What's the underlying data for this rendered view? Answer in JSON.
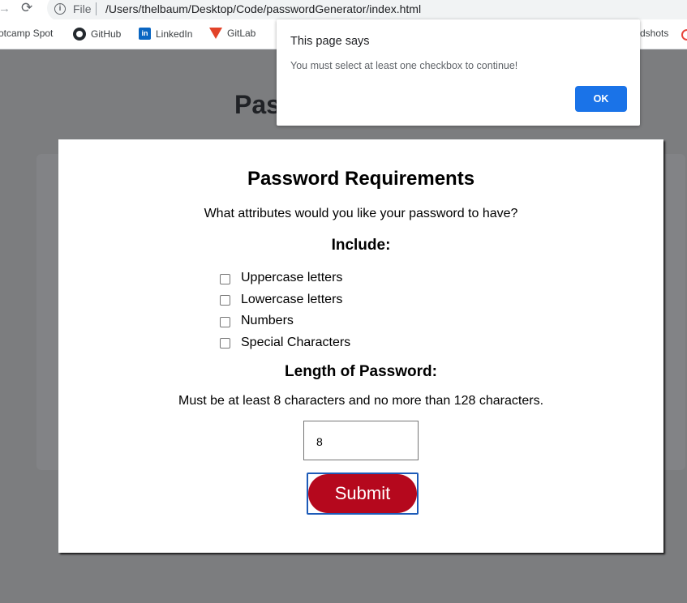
{
  "browser": {
    "file_label": "File",
    "url": "/Users/thelbaum/Desktop/Code/passwordGenerator/index.html",
    "bookmarks": [
      {
        "label": "otcamp Spot",
        "icon": "bootcamp-spot-icon"
      },
      {
        "label": "GitHub",
        "icon": "github-icon"
      },
      {
        "label": "LinkedIn",
        "icon": "linkedin-icon"
      },
      {
        "label": "GitLab",
        "icon": "gitlab-icon"
      },
      {
        "label": "dshots",
        "icon": ""
      }
    ]
  },
  "page": {
    "heading_partial": "Pas"
  },
  "alert": {
    "title": "This page says",
    "message": "You must select at least one checkbox to continue!",
    "ok_label": "OK",
    "ok_color": "#1a73e8"
  },
  "form": {
    "title": "Password Requirements",
    "question": "What attributes would you like your password to have?",
    "include_label": "Include:",
    "checkboxes": [
      {
        "label": "Uppercase letters",
        "checked": false
      },
      {
        "label": "Lowercase letters",
        "checked": false
      },
      {
        "label": "Numbers",
        "checked": false
      },
      {
        "label": "Special Characters",
        "checked": false
      }
    ],
    "length_title": "Length of Password:",
    "length_note": "Must be at least 8 characters and no more than 128 characters.",
    "length_value": "8",
    "submit_label": "Submit",
    "submit_color": "#b5081d"
  }
}
